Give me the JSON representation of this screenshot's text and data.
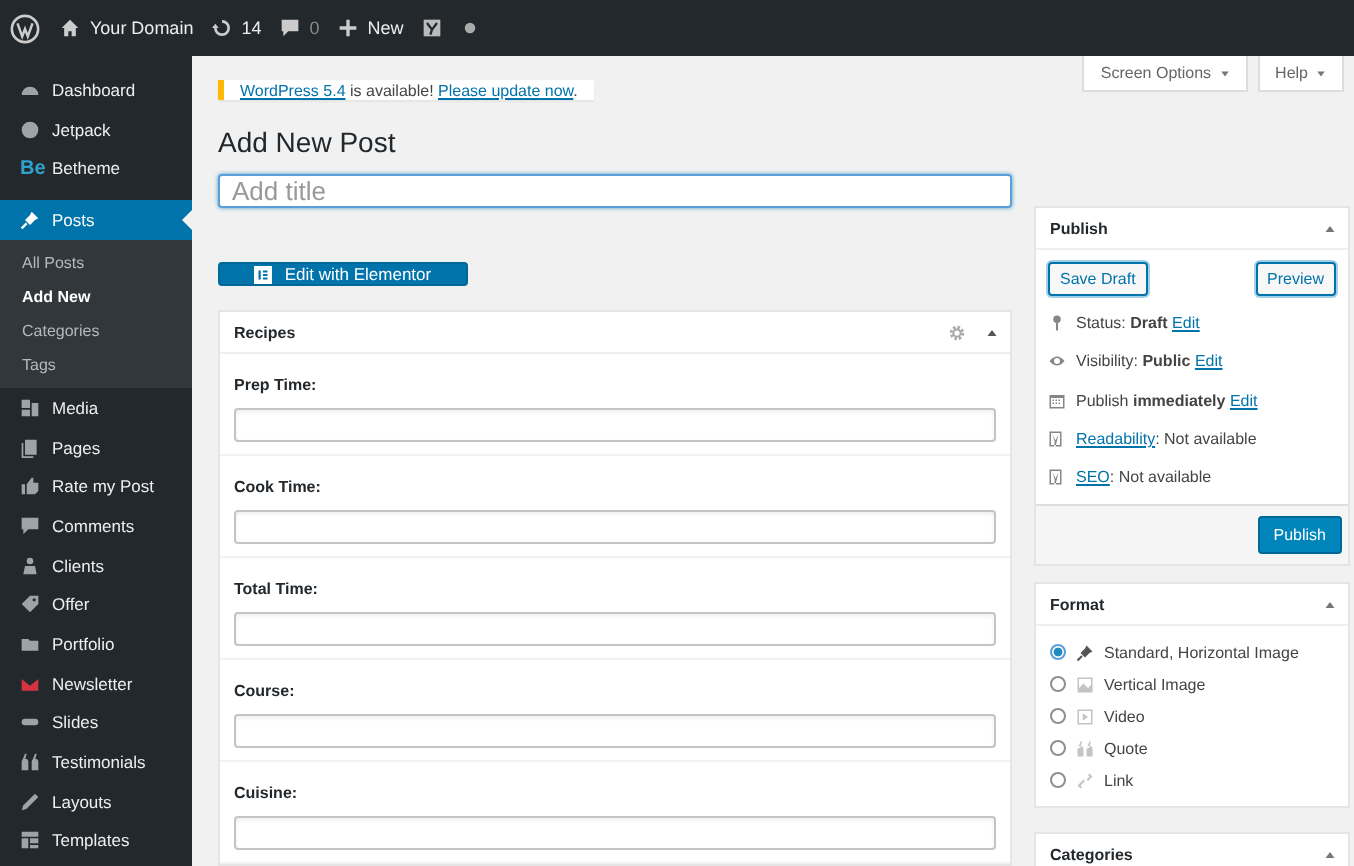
{
  "admin_bar": {
    "site_name": "Your Domain",
    "updates": "14",
    "comments": "0",
    "new_label": "New"
  },
  "sidebar": {
    "items": [
      {
        "kind": "dashboard",
        "label": "Dashboard",
        "selected": false
      },
      {
        "kind": "jetpack",
        "label": "Jetpack",
        "selected": false
      },
      {
        "kind": "logo",
        "logo_text": "Be",
        "label": "Betheme",
        "selected": false
      },
      {
        "kind": "posts",
        "label": "Posts",
        "selected": true,
        "children": [
          {
            "label": "All Posts",
            "selected": false
          },
          {
            "label": "Add New",
            "selected": true
          },
          {
            "label": "Categories",
            "selected": false
          },
          {
            "label": "Tags",
            "selected": false
          }
        ]
      },
      {
        "kind": "media",
        "label": "Media",
        "selected": false
      },
      {
        "kind": "pages",
        "label": "Pages",
        "selected": false
      },
      {
        "kind": "rate",
        "label": "Rate my Post",
        "selected": false
      },
      {
        "kind": "comments",
        "label": "Comments",
        "selected": false
      },
      {
        "kind": "clients",
        "label": "Clients",
        "selected": false
      },
      {
        "kind": "offer",
        "label": "Offer",
        "selected": false
      },
      {
        "kind": "portfolio",
        "label": "Portfolio",
        "selected": false
      },
      {
        "kind": "newsletter",
        "label": "Newsletter",
        "selected": false
      },
      {
        "kind": "slides",
        "label": "Slides",
        "selected": false
      },
      {
        "kind": "testimonials",
        "label": "Testimonials",
        "selected": false
      },
      {
        "kind": "layouts",
        "label": "Layouts",
        "selected": false
      },
      {
        "kind": "templates",
        "label": "Templates",
        "selected": false
      }
    ]
  },
  "screen_tabs": [
    "Screen Options",
    "Help"
  ],
  "notice": {
    "version_link": "WordPress 5.4",
    "text": " is available! ",
    "update_link": "Please update now",
    "end": "."
  },
  "page_title": "Add New Post",
  "title_field": {
    "placeholder": "Add title"
  },
  "elementor_button": "Edit with Elementor",
  "recipes": {
    "title": "Recipes",
    "fields": [
      {
        "label": "Prep Time:"
      },
      {
        "label": "Cook Time:"
      },
      {
        "label": "Total Time:"
      },
      {
        "label": "Course:"
      },
      {
        "label": "Cuisine:"
      }
    ]
  },
  "publish": {
    "title": "Publish",
    "save_draft": "Save Draft",
    "preview": "Preview",
    "rows": [
      {
        "kind": "status",
        "text": "Status: **Draft** ",
        "link": "Edit"
      },
      {
        "kind": "visibility",
        "text": "Visibility: **Public** ",
        "link": "Edit"
      },
      {
        "kind": "schedule",
        "text": "Publish **immediately** ",
        "link": "Edit"
      },
      {
        "kind": "readability",
        "link": "Readability",
        "text": ": Not available"
      },
      {
        "kind": "seo",
        "link": "SEO",
        "text": ": Not available"
      }
    ],
    "publish_button": "Publish"
  },
  "format": {
    "title": "Format",
    "options": [
      {
        "kind": "standard",
        "label": "Standard, Horizontal Image",
        "selected": true
      },
      {
        "kind": "image",
        "label": "Vertical Image",
        "selected": false
      },
      {
        "kind": "video",
        "label": "Video",
        "selected": false
      },
      {
        "kind": "quote",
        "label": "Quote",
        "selected": false
      },
      {
        "kind": "link",
        "label": "Link",
        "selected": false
      }
    ]
  },
  "categories": {
    "title": "Categories"
  }
}
